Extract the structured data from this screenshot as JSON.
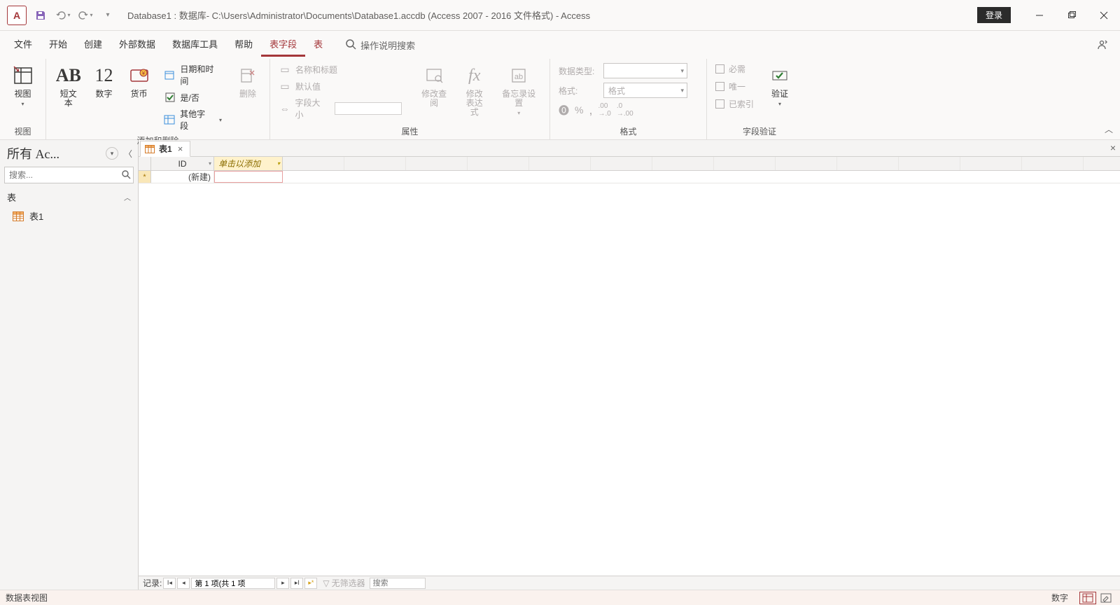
{
  "title": "Database1 : 数据库- C:\\Users\\Administrator\\Documents\\Database1.accdb (Access 2007 - 2016 文件格式)  -  Access",
  "login": "登录",
  "menu": {
    "file": "文件",
    "home": "开始",
    "create": "创建",
    "external": "外部数据",
    "dbtools": "数据库工具",
    "help": "帮助",
    "fields": "表字段",
    "table": "表",
    "tellme_placeholder": "操作说明搜索"
  },
  "ribbon": {
    "group_view": "视图",
    "view_btn": "视图",
    "group_adddelete": "添加和删除",
    "shorttext": "短文本",
    "number": "数字",
    "currency": "货币",
    "datetime": "日期和时间",
    "yesno": "是/否",
    "morefields": "其他字段",
    "delete": "删除",
    "group_props": "属性",
    "namecaption": "名称和标题",
    "default": "默认值",
    "fieldsize": "字段大小",
    "modlookup": "修改查阅",
    "modexpr": "修改\n表达式",
    "memo": "备忘录设置",
    "group_format": "格式",
    "datatype_lbl": "数据类型:",
    "format_lbl": "格式:",
    "format_ph": "格式",
    "group_validation": "字段验证",
    "required": "必需",
    "unique": "唯一",
    "indexed": "已索引",
    "validate": "验证"
  },
  "nav": {
    "title": "所有 Ac...",
    "search_ph": "搜索...",
    "group_tables": "表",
    "item_table1": "表1"
  },
  "doc": {
    "tab_name": "表1",
    "col_id": "ID",
    "col_add": "单击以添加",
    "row_new": "(新建)",
    "rec_label": "记录:",
    "rec_pos": "第 1 项(共 1 项",
    "nofilter": "无筛选器",
    "search_ph": "搜索"
  },
  "status": {
    "left": "数据表视图",
    "numlock": "数字"
  }
}
